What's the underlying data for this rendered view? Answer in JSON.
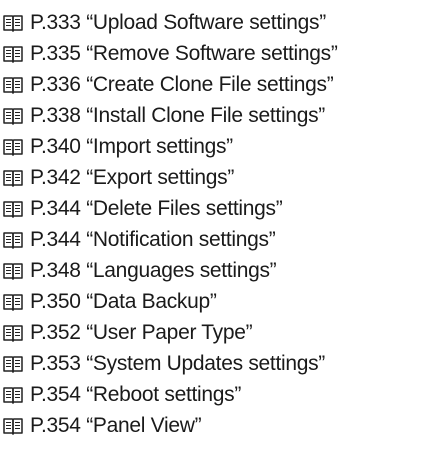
{
  "references": [
    {
      "icon": "book-icon",
      "page": "P.333",
      "title": "“Upload Software settings”"
    },
    {
      "icon": "book-icon",
      "page": "P.335",
      "title": "“Remove Software settings”"
    },
    {
      "icon": "book-icon",
      "page": "P.336",
      "title": "“Create Clone File settings”"
    },
    {
      "icon": "book-icon",
      "page": "P.338",
      "title": "“Install Clone File settings”"
    },
    {
      "icon": "book-icon",
      "page": "P.340",
      "title": "“Import settings”"
    },
    {
      "icon": "book-icon",
      "page": "P.342",
      "title": "“Export settings”"
    },
    {
      "icon": "book-icon",
      "page": "P.344",
      "title": "“Delete Files settings”"
    },
    {
      "icon": "book-icon",
      "page": "P.344",
      "title": "“Notification settings”"
    },
    {
      "icon": "book-icon",
      "page": "P.348",
      "title": "“Languages settings”"
    },
    {
      "icon": "book-icon",
      "page": "P.350",
      "title": "“Data Backup”"
    },
    {
      "icon": "book-icon",
      "page": "P.352",
      "title": "“User Paper Type”"
    },
    {
      "icon": "book-icon",
      "page": "P.353",
      "title": "“System Updates settings”"
    },
    {
      "icon": "book-icon",
      "page": "P.354",
      "title": "“Reboot settings”"
    },
    {
      "icon": "book-icon",
      "page": "P.354",
      "title": "“Panel View”"
    }
  ]
}
